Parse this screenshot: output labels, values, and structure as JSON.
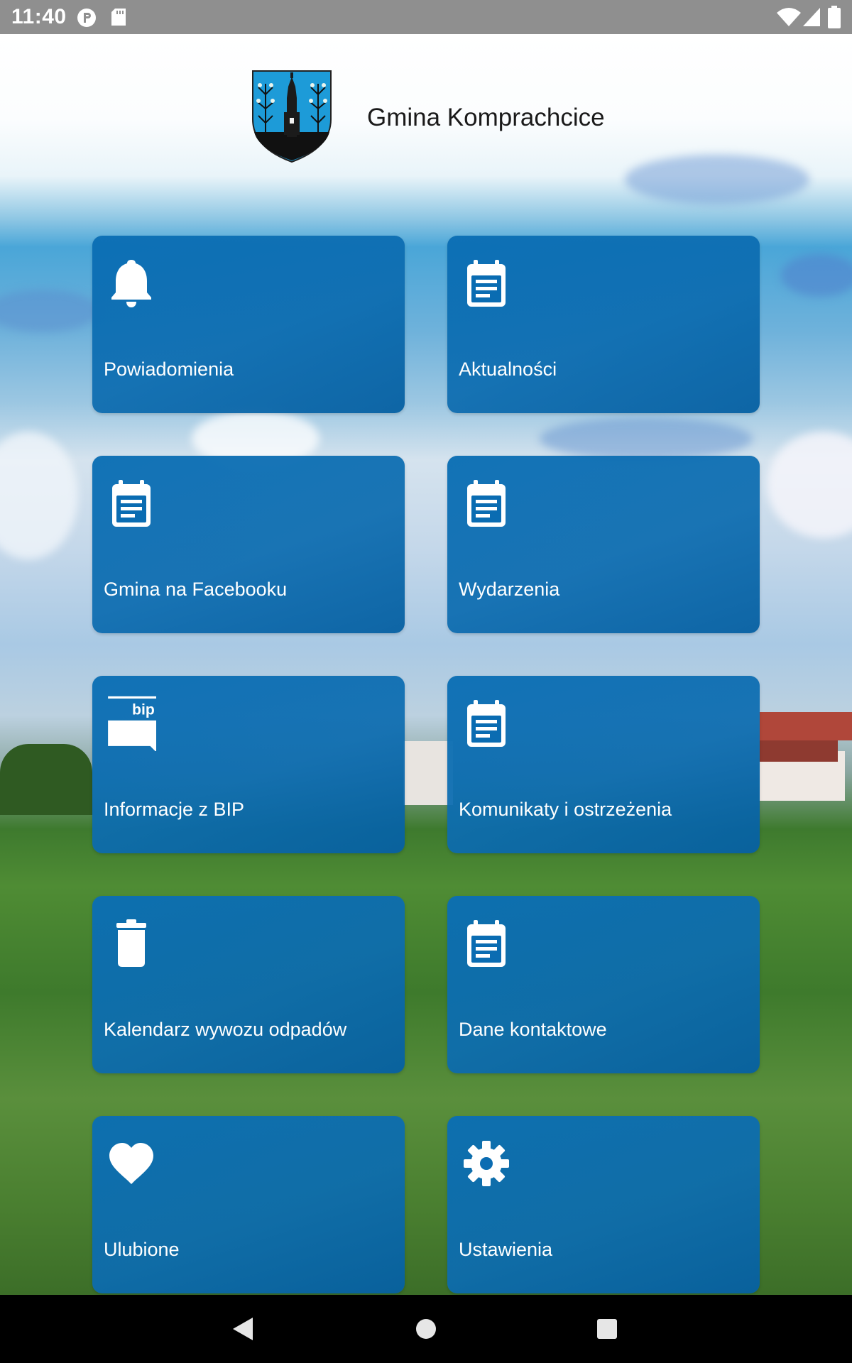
{
  "status_bar": {
    "time": "11:40"
  },
  "header": {
    "title": "Gmina Komprachcice"
  },
  "tiles": [
    {
      "label": "Powiadomienia",
      "icon": "bell-icon"
    },
    {
      "label": "Aktualności",
      "icon": "calendar-note-icon"
    },
    {
      "label": "Gmina na Facebooku",
      "icon": "calendar-note-icon"
    },
    {
      "label": "Wydarzenia",
      "icon": "calendar-note-icon"
    },
    {
      "label": "Informacje z BIP",
      "icon": "bip-icon",
      "icon_text": "bip"
    },
    {
      "label": "Komunikaty i ostrzeżenia",
      "icon": "calendar-note-icon"
    },
    {
      "label": "Kalendarz wywozu odpadów",
      "icon": "trash-icon"
    },
    {
      "label": "Dane kontaktowe",
      "icon": "calendar-note-icon"
    },
    {
      "label": "Ulubione",
      "icon": "heart-icon"
    },
    {
      "label": "Ustawienia",
      "icon": "gear-icon"
    }
  ],
  "colors": {
    "tile": "#0A6EB4",
    "status_bar": "#8F8F8F",
    "nav_bar": "#000000"
  }
}
